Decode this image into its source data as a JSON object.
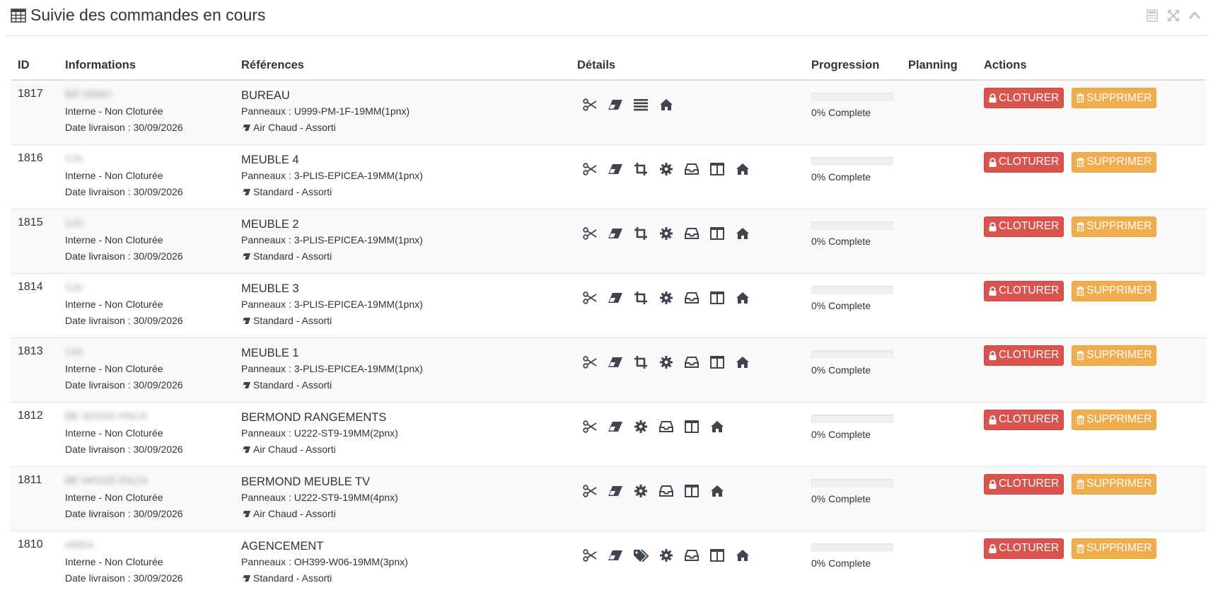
{
  "widget": {
    "title": "Suivie des commandes en cours",
    "icons": [
      "table-icon",
      "calculator-icon",
      "expand-icon",
      "collapse-icon"
    ]
  },
  "colors": {
    "danger": "#d9534f",
    "warning": "#f0ad4e",
    "icon": "#3f4550",
    "progress_track": "#f0f0f0"
  },
  "table": {
    "headers": {
      "id": "ID",
      "informations": "Informations",
      "references": "Références",
      "details": "Détails",
      "progression": "Progression",
      "planning": "Planning",
      "actions": "Actions"
    },
    "rows": [
      {
        "id": "1817",
        "client": "BR IMMO",
        "status": "Interne - Non Cloturée",
        "delivery": "Date livraison : 30/09/2026",
        "ref_title": "BUREAU",
        "panels": "Panneaux : U999-PM-1F-19MM(1pnx)",
        "edge": "Air Chaud - Assorti",
        "details": [
          "scissors-icon",
          "eraser-icon",
          "list-icon",
          "home-icon"
        ],
        "progress": 0,
        "progress_label": "0% Complete",
        "planning": "",
        "close_label": "CLOTURER",
        "delete_label": "SUPPRIMER"
      },
      {
        "id": "1816",
        "client": "CAI",
        "status": "Interne - Non Cloturée",
        "delivery": "Date livraison : 30/09/2026",
        "ref_title": "MEUBLE 4",
        "panels": "Panneaux : 3-PLIS-EPICEA-19MM(1pnx)",
        "edge": "Standard - Assorti",
        "details": [
          "scissors-icon",
          "eraser-icon",
          "crop-icon",
          "gear-icon",
          "inbox-icon",
          "columns-icon",
          "home-icon"
        ],
        "progress": 0,
        "progress_label": "0% Complete",
        "planning": "",
        "close_label": "CLOTURER",
        "delete_label": "SUPPRIMER"
      },
      {
        "id": "1815",
        "client": "CAI",
        "status": "Interne - Non Cloturée",
        "delivery": "Date livraison : 30/09/2026",
        "ref_title": "MEUBLE 2",
        "panels": "Panneaux : 3-PLIS-EPICEA-19MM(1pnx)",
        "edge": "Standard - Assorti",
        "details": [
          "scissors-icon",
          "eraser-icon",
          "crop-icon",
          "gear-icon",
          "inbox-icon",
          "columns-icon",
          "home-icon"
        ],
        "progress": 0,
        "progress_label": "0% Complete",
        "planning": "",
        "close_label": "CLOTURER",
        "delete_label": "SUPPRIMER"
      },
      {
        "id": "1814",
        "client": "CAI",
        "status": "Interne - Non Cloturée",
        "delivery": "Date livraison : 30/09/2026",
        "ref_title": "MEUBLE 3",
        "panels": "Panneaux : 3-PLIS-EPICEA-19MM(1pnx)",
        "edge": "Standard - Assorti",
        "details": [
          "scissors-icon",
          "eraser-icon",
          "crop-icon",
          "gear-icon",
          "inbox-icon",
          "columns-icon",
          "home-icon"
        ],
        "progress": 0,
        "progress_label": "0% Complete",
        "planning": "",
        "close_label": "CLOTURER",
        "delete_label": "SUPPRIMER"
      },
      {
        "id": "1813",
        "client": "CAI",
        "status": "Interne - Non Cloturée",
        "delivery": "Date livraison : 30/09/2026",
        "ref_title": "MEUBLE 1",
        "panels": "Panneaux : 3-PLIS-EPICEA-19MM(1pnx)",
        "edge": "Standard - Assorti",
        "details": [
          "scissors-icon",
          "eraser-icon",
          "crop-icon",
          "gear-icon",
          "inbox-icon",
          "columns-icon",
          "home-icon"
        ],
        "progress": 0,
        "progress_label": "0% Complete",
        "planning": "",
        "close_label": "CLOTURER",
        "delete_label": "SUPPRIMER"
      },
      {
        "id": "1812",
        "client": "BE WOOD PACA",
        "status": "Interne - Non Cloturée",
        "delivery": "Date livraison : 30/09/2026",
        "ref_title": "BERMOND RANGEMENTS",
        "panels": "Panneaux : U222-ST9-19MM(2pnx)",
        "edge": "Air Chaud - Assorti",
        "details": [
          "scissors-icon",
          "eraser-icon",
          "gear-icon",
          "inbox-icon",
          "columns-icon",
          "home-icon"
        ],
        "progress": 0,
        "progress_label": "0% Complete",
        "planning": "",
        "close_label": "CLOTURER",
        "delete_label": "SUPPRIMER"
      },
      {
        "id": "1811",
        "client": "BE WOOD PACA",
        "status": "Interne - Non Cloturée",
        "delivery": "Date livraison : 30/09/2026",
        "ref_title": "BERMOND MEUBLE TV",
        "panels": "Panneaux : U222-ST9-19MM(4pnx)",
        "edge": "Air Chaud - Assorti",
        "details": [
          "scissors-icon",
          "eraser-icon",
          "gear-icon",
          "inbox-icon",
          "columns-icon",
          "home-icon"
        ],
        "progress": 0,
        "progress_label": "0% Complete",
        "planning": "",
        "close_label": "CLOTURER",
        "delete_label": "SUPPRIMER"
      },
      {
        "id": "1810",
        "client": "AREA",
        "status": "Interne - Non Cloturée",
        "delivery": "Date livraison : 30/09/2026",
        "ref_title": "AGENCEMENT",
        "panels": "Panneaux : OH399-W06-19MM(3pnx)",
        "edge": "Standard - Assorti",
        "details": [
          "scissors-icon",
          "eraser-icon",
          "tags-icon",
          "gear-icon",
          "inbox-icon",
          "columns-icon",
          "home-icon"
        ],
        "progress": 0,
        "progress_label": "0% Complete",
        "planning": "",
        "close_label": "CLOTURER",
        "delete_label": "SUPPRIMER"
      }
    ]
  }
}
